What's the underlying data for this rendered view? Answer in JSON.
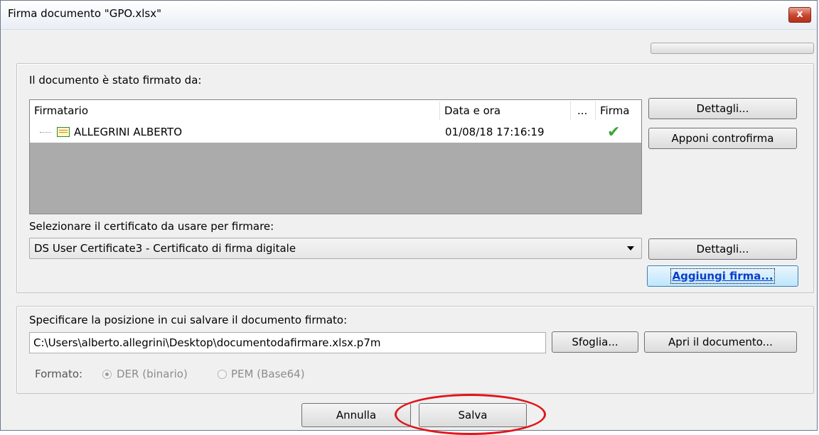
{
  "window": {
    "title": "Firma documento \"GPO.xlsx\"",
    "close_glyph": "x"
  },
  "signed_section": {
    "label": "Il documento è stato firmato da:",
    "columns": [
      "Firmatario",
      "Data e ora",
      "...",
      "Firma"
    ],
    "rows": [
      {
        "signer": "ALLEGRINI ALBERTO",
        "datetime": "01/08/18 17:16:19",
        "status_icon": "check-icon"
      }
    ],
    "details_button": "Dettagli...",
    "countersign_button": "Apponi controfirma"
  },
  "certificate_section": {
    "label": "Selezionare il certificato da usare per firmare:",
    "selected": "DS User Certificate3 - Certificato di firma digitale",
    "details_button": "Dettagli...",
    "add_signature_button": "Aggiungi firma..."
  },
  "save_section": {
    "label": "Specificare la posizione in cui salvare il documento firmato:",
    "path_value": "C:\\Users\\alberto.allegrini\\Desktop\\documentodafirmare.xlsx.p7m",
    "browse_button": "Sfoglia...",
    "open_button": "Apri il documento...",
    "format_label": "Formato:",
    "format_options": [
      "DER (binario)",
      "PEM (Base64)"
    ],
    "format_selected": "DER (binario)"
  },
  "footer": {
    "cancel_button": "Annulla",
    "save_button": "Salva"
  },
  "colors": {
    "highlight": "#e0151b",
    "accent": "#0b3ec9",
    "check": "#3aa53a"
  }
}
